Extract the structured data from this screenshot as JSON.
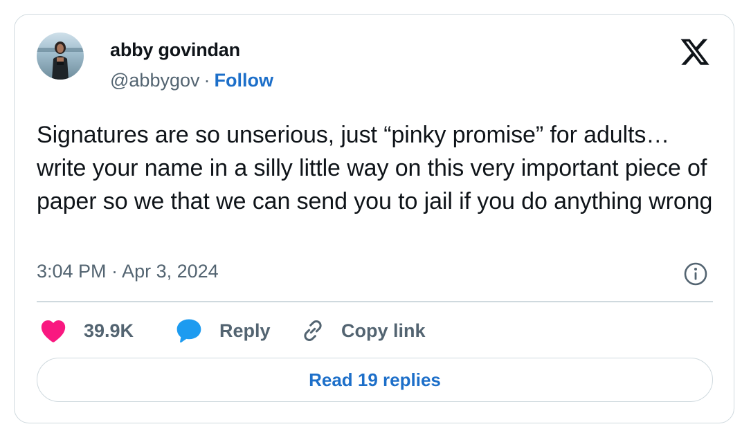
{
  "author": {
    "display_name": "abby govindan",
    "handle": "@abbygov",
    "separator": "·",
    "follow_label": "Follow",
    "avatar_icon": "user-photo-avatar"
  },
  "tweet": {
    "text": "Signatures are so unserious, just “pinky promise” for adults… write your name in a silly little way on this very important piece of paper so we that we can send you to jail if you do anything wrong",
    "timestamp": "3:04 PM · Apr 3, 2024"
  },
  "actions": {
    "like_count": "39.9K",
    "like_icon": "heart-icon",
    "reply_label": "Reply",
    "reply_icon": "speech-bubble-icon",
    "copy_label": "Copy link",
    "copy_icon": "link-icon"
  },
  "footer": {
    "read_replies_label": "Read 19 replies"
  },
  "icons": {
    "brand": "x-logo-icon",
    "info": "info-icon"
  },
  "colors": {
    "text_primary": "#0f1419",
    "text_secondary": "#536471",
    "link_blue": "#1d6fc9",
    "heart_pink": "#f91880",
    "reply_blue": "#1d9bf0",
    "border": "#cfd9de"
  }
}
